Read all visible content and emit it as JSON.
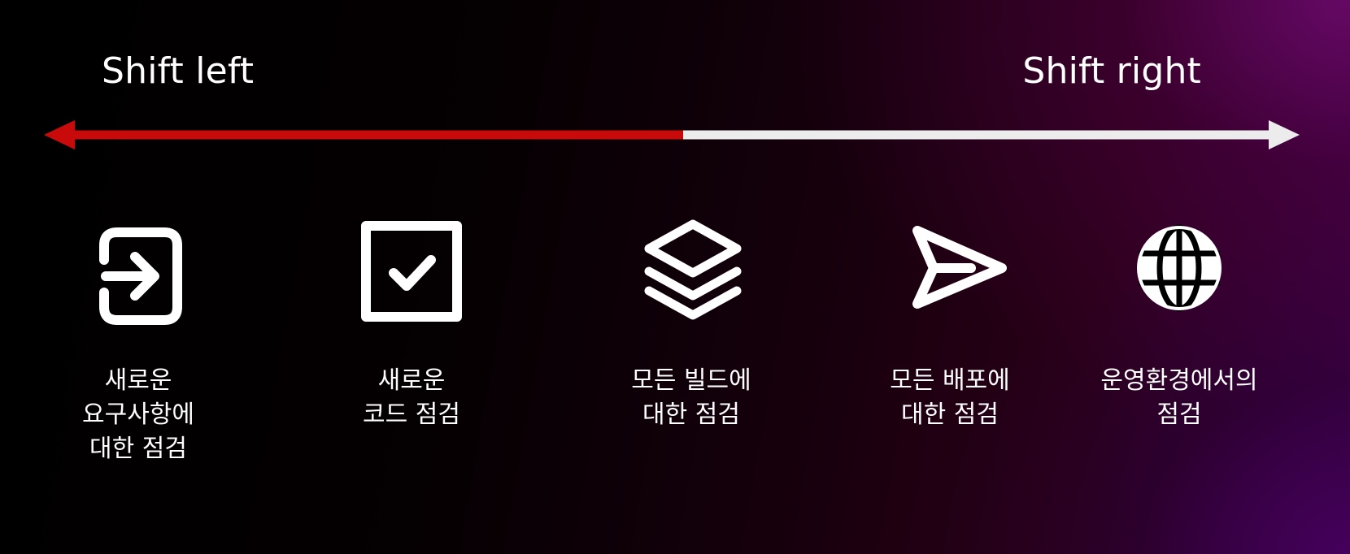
{
  "labels": {
    "left": "Shift left",
    "right": "Shift right"
  },
  "colors": {
    "left_segment": "#c80a0a",
    "right_segment": "#ececec",
    "icon": "#ffffff",
    "text": "#ffffff"
  },
  "steps": [
    {
      "icon": "login-icon",
      "lines": [
        "새로운",
        "요구사항에",
        "대한 점검"
      ]
    },
    {
      "icon": "checkbox-icon",
      "lines": [
        "새로운",
        "코드 점검"
      ]
    },
    {
      "icon": "layers-icon",
      "lines": [
        "모든 빌드에",
        "대한 점검"
      ]
    },
    {
      "icon": "send-icon",
      "lines": [
        "모든 배포에",
        "대한 점검"
      ]
    },
    {
      "icon": "globe-icon",
      "lines": [
        "운영환경에서의",
        "점검"
      ]
    }
  ]
}
